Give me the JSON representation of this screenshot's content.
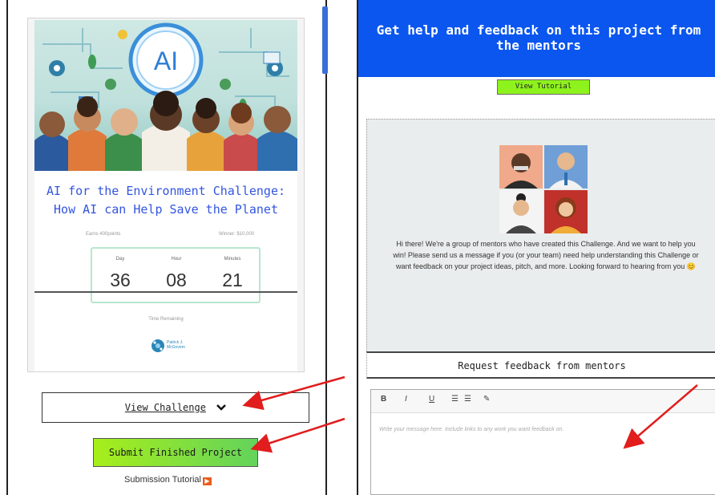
{
  "left_panel": {
    "hero_badge": "AI",
    "challenge_title": "AI for the Environment Challenge: How AI can Help Save the Planet",
    "earn_label": "Earns 400points",
    "winner_label": "Winner: $10,000",
    "countdown": [
      {
        "label": "Day",
        "value": "36"
      },
      {
        "label": "Hour",
        "value": "08"
      },
      {
        "label": "Minutes",
        "value": "21"
      }
    ],
    "time_remaining_label": "Time Remaining",
    "org_logo_text": "Patrick J. McGovern",
    "view_challenge_label": "View Challenge",
    "submit_label": "Submit Finished Project",
    "submission_tutorial_label": "Submission Tutorial",
    "submission_tutorial_icon": "▶"
  },
  "right_panel": {
    "title": "Get help and feedback on this project from the mentors",
    "view_tutorial_label": "View Tutorial",
    "mentor_message": "Hi there! We're a group of mentors who have created this Challenge. And we want to help you win! Please send us a message if you (or your team) need help understanding this Challenge or want feedback on your project ideas, pitch, and more. Looking forward to hearing from you 😊",
    "request_title": "Request feedback from mentors",
    "toolbar": {
      "bold": "B",
      "italic": "I",
      "underline": "U",
      "ordered_list": "☰",
      "bullet_list": "☰",
      "link": "✎"
    },
    "editor_placeholder": "Write your message here. Include links to any work you want feedback on."
  },
  "colors": {
    "header_blue": "#0a56ef",
    "title_blue": "#3355e0",
    "submit_green": "#a7ee1b",
    "tutorial_green": "#8ef21c",
    "annotation_red": "#e11d1d"
  }
}
